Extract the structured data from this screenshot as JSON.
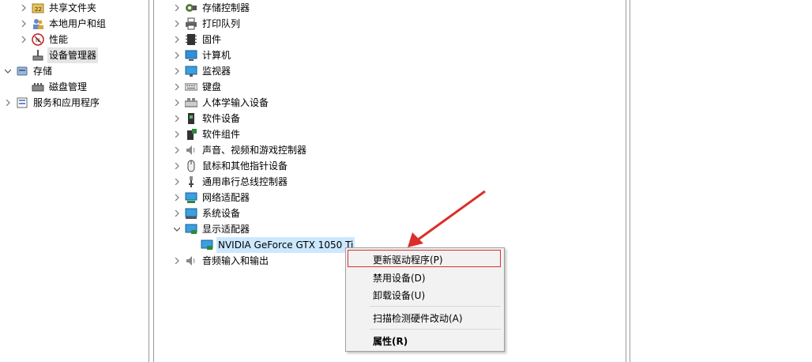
{
  "left_tree": [
    {
      "label": "共享文件夹",
      "icon": "shared-folder-icon",
      "expand": "collapsed"
    },
    {
      "label": "本地用户和组",
      "icon": "local-users-icon",
      "expand": "collapsed"
    },
    {
      "label": "性能",
      "icon": "performance-icon",
      "expand": "collapsed"
    },
    {
      "label": "设备管理器",
      "icon": "device-manager-icon",
      "expand": "none",
      "selected": true
    },
    {
      "label": "存储",
      "icon": "storage-icon",
      "expand": "expanded"
    },
    {
      "label": "磁盘管理",
      "icon": "disk-management-icon",
      "expand": "none"
    },
    {
      "label": "服务和应用程序",
      "icon": "services-apps-icon",
      "expand": "collapsed"
    }
  ],
  "device_tree": [
    {
      "label": "存储控制器",
      "icon": "storage-controller-icon",
      "expand": "collapsed"
    },
    {
      "label": "打印队列",
      "icon": "printer-icon",
      "expand": "collapsed"
    },
    {
      "label": "固件",
      "icon": "firmware-icon",
      "expand": "collapsed"
    },
    {
      "label": "计算机",
      "icon": "computer-icon",
      "expand": "collapsed"
    },
    {
      "label": "监视器",
      "icon": "monitor-icon",
      "expand": "collapsed"
    },
    {
      "label": "键盘",
      "icon": "keyboard-icon",
      "expand": "collapsed"
    },
    {
      "label": "人体学输入设备",
      "icon": "hid-icon",
      "expand": "collapsed"
    },
    {
      "label": "软件设备",
      "icon": "software-device-icon",
      "expand": "collapsed"
    },
    {
      "label": "软件组件",
      "icon": "software-component-icon",
      "expand": "collapsed"
    },
    {
      "label": "声音、视频和游戏控制器",
      "icon": "speaker-icon",
      "expand": "collapsed"
    },
    {
      "label": "鼠标和其他指针设备",
      "icon": "mouse-icon",
      "expand": "collapsed"
    },
    {
      "label": "通用串行总线控制器",
      "icon": "usb-icon",
      "expand": "collapsed"
    },
    {
      "label": "网络适配器",
      "icon": "network-adapter-icon",
      "expand": "collapsed"
    },
    {
      "label": "系统设备",
      "icon": "system-device-icon",
      "expand": "collapsed"
    },
    {
      "label": "显示适配器",
      "icon": "display-adapter-icon",
      "expand": "expanded"
    },
    {
      "label": "NVIDIA GeForce GTX 1050 Ti",
      "icon": "gpu-icon",
      "expand": "none",
      "child": true,
      "selected": true
    },
    {
      "label": "音频输入和输出",
      "icon": "audio-io-icon",
      "expand": "collapsed"
    }
  ],
  "context_menu": {
    "items": [
      {
        "label": "更新驱动程序(P)",
        "highlighted": true
      },
      {
        "label": "禁用设备(D)"
      },
      {
        "label": "卸载设备(U)"
      },
      {
        "label": "扫描检测硬件改动(A)"
      },
      {
        "label": "属性(R)",
        "bold": true
      }
    ]
  },
  "colors": {
    "annotation_red": "#d9302a",
    "selection_blue": "#cce8ff",
    "menu_bg": "#f2f2f2"
  }
}
